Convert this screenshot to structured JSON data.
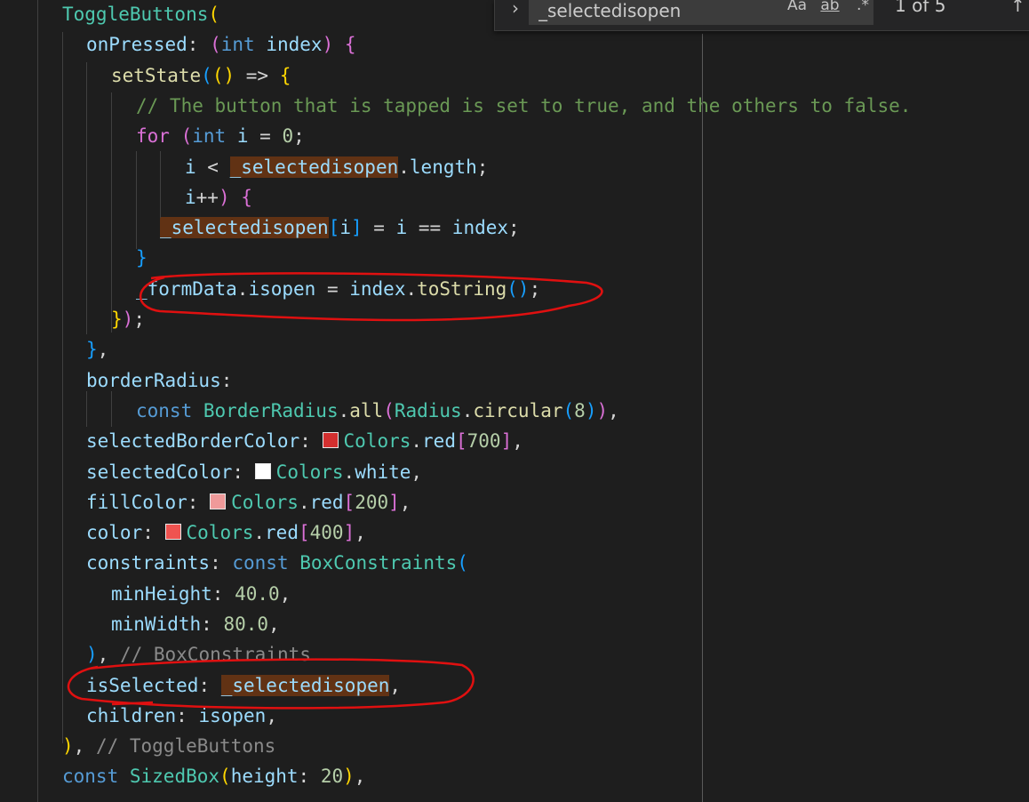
{
  "find_widget": {
    "toggle_icon": "chevron-right-icon",
    "query": "_selectedisopen",
    "match_case_label": "Aa",
    "whole_word_label": "ab",
    "regex_label": ".*",
    "match_count": "1 of 5",
    "prev_icon": "arrow-up-icon"
  },
  "colors": {
    "keyword": "#569cd6",
    "type": "#4ec9b0",
    "function": "#dcdcaa",
    "variable": "#9cdcfe",
    "number": "#b5cea8",
    "comment": "#6a9955",
    "text": "#d4d4d4",
    "bracket_gold": "#ffd700",
    "bracket_pink": "#da70d6",
    "bracket_blue": "#179fff",
    "find_highlight": "#613214",
    "annotation": "#e01010"
  },
  "code_lines": [
    {
      "tokens": [
        {
          "t": "ToggleButtons",
          "c": "type"
        },
        {
          "t": "(",
          "c": "bracket_gold"
        }
      ]
    },
    {
      "tokens": [
        {
          "t": "onPressed",
          "c": "variable"
        },
        {
          "t": ": ",
          "c": "text"
        },
        {
          "t": "(",
          "c": "bracket_pink"
        },
        {
          "t": "int",
          "c": "keyword"
        },
        {
          "t": " ",
          "c": "text"
        },
        {
          "t": "index",
          "c": "variable"
        },
        {
          "t": ") ",
          "c": "bracket_pink"
        },
        {
          "t": "{",
          "c": "bracket_pink"
        }
      ]
    },
    {
      "tokens": [
        {
          "t": "setState",
          "c": "function"
        },
        {
          "t": "(",
          "c": "bracket_blue"
        },
        {
          "t": "()",
          "c": "bracket_gold"
        },
        {
          "t": " => ",
          "c": "text"
        },
        {
          "t": "{",
          "c": "bracket_gold"
        }
      ]
    },
    {
      "tokens": [
        {
          "t": "// The button that is tapped is set to true, and the others to false.",
          "c": "comment"
        }
      ]
    },
    {
      "tokens": [
        {
          "t": "for",
          "c": "bracket_pink"
        },
        {
          "t": " ",
          "c": "text"
        },
        {
          "t": "(",
          "c": "bracket_pink"
        },
        {
          "t": "int",
          "c": "keyword"
        },
        {
          "t": " ",
          "c": "text"
        },
        {
          "t": "i",
          "c": "variable"
        },
        {
          "t": " = ",
          "c": "text"
        },
        {
          "t": "0",
          "c": "number"
        },
        {
          "t": ";",
          "c": "text"
        }
      ]
    },
    {
      "tokens": [
        {
          "t": "i",
          "c": "variable"
        },
        {
          "t": " < ",
          "c": "text"
        },
        {
          "t": "_selectedisopen",
          "c": "variable",
          "hl": true
        },
        {
          "t": ".",
          "c": "text"
        },
        {
          "t": "length",
          "c": "variable"
        },
        {
          "t": ";",
          "c": "text"
        }
      ]
    },
    {
      "tokens": [
        {
          "t": "i",
          "c": "variable"
        },
        {
          "t": "++",
          "c": "text"
        },
        {
          "t": ") ",
          "c": "bracket_pink"
        },
        {
          "t": "{",
          "c": "bracket_pink"
        }
      ]
    },
    {
      "tokens": [
        {
          "t": "_selectedisopen",
          "c": "variable",
          "hl": true
        },
        {
          "t": "[",
          "c": "bracket_blue"
        },
        {
          "t": "i",
          "c": "variable"
        },
        {
          "t": "]",
          "c": "bracket_blue"
        },
        {
          "t": " = ",
          "c": "text"
        },
        {
          "t": "i",
          "c": "variable"
        },
        {
          "t": " == ",
          "c": "text"
        },
        {
          "t": "index",
          "c": "variable"
        },
        {
          "t": ";",
          "c": "text"
        }
      ]
    },
    {
      "tokens": [
        {
          "t": "}",
          "c": "bracket_blue"
        }
      ]
    },
    {
      "tokens": [
        {
          "t": "_formData",
          "c": "variable"
        },
        {
          "t": ".",
          "c": "text"
        },
        {
          "t": "isopen",
          "c": "variable"
        },
        {
          "t": " = ",
          "c": "text"
        },
        {
          "t": "index",
          "c": "variable"
        },
        {
          "t": ".",
          "c": "text"
        },
        {
          "t": "toString",
          "c": "function"
        },
        {
          "t": "()",
          "c": "bracket_blue"
        },
        {
          "t": ";",
          "c": "text"
        }
      ]
    },
    {
      "tokens": [
        {
          "t": "}",
          "c": "bracket_gold"
        },
        {
          "t": ")",
          "c": "bracket_pink"
        },
        {
          "t": ";",
          "c": "text"
        }
      ]
    },
    {
      "tokens": [
        {
          "t": "}",
          "c": "bracket_blue"
        },
        {
          "t": ",",
          "c": "text"
        }
      ]
    },
    {
      "tokens": [
        {
          "t": "borderRadius",
          "c": "variable"
        },
        {
          "t": ":",
          "c": "text"
        }
      ]
    },
    {
      "tokens": [
        {
          "t": "const",
          "c": "keyword"
        },
        {
          "t": " ",
          "c": "text"
        },
        {
          "t": "BorderRadius",
          "c": "type"
        },
        {
          "t": ".",
          "c": "text"
        },
        {
          "t": "all",
          "c": "function"
        },
        {
          "t": "(",
          "c": "bracket_pink"
        },
        {
          "t": "Radius",
          "c": "type"
        },
        {
          "t": ".",
          "c": "text"
        },
        {
          "t": "circular",
          "c": "function"
        },
        {
          "t": "(",
          "c": "bracket_blue"
        },
        {
          "t": "8",
          "c": "number"
        },
        {
          "t": ")",
          "c": "bracket_blue"
        },
        {
          "t": ")",
          "c": "bracket_pink"
        },
        {
          "t": ",",
          "c": "text"
        }
      ]
    },
    {
      "tokens": [
        {
          "t": "selectedBorderColor",
          "c": "variable"
        },
        {
          "t": ": ",
          "c": "text"
        },
        {
          "swatch": "#d32f2f"
        },
        {
          "t": "Colors",
          "c": "type"
        },
        {
          "t": ".",
          "c": "text"
        },
        {
          "t": "red",
          "c": "variable"
        },
        {
          "t": "[",
          "c": "bracket_pink"
        },
        {
          "t": "700",
          "c": "number"
        },
        {
          "t": "]",
          "c": "bracket_pink"
        },
        {
          "t": ",",
          "c": "text"
        }
      ]
    },
    {
      "tokens": [
        {
          "t": "selectedColor",
          "c": "variable"
        },
        {
          "t": ": ",
          "c": "text"
        },
        {
          "swatch": "#ffffff"
        },
        {
          "t": "Colors",
          "c": "type"
        },
        {
          "t": ".",
          "c": "text"
        },
        {
          "t": "white",
          "c": "variable"
        },
        {
          "t": ",",
          "c": "text"
        }
      ]
    },
    {
      "tokens": [
        {
          "t": "fillColor",
          "c": "variable"
        },
        {
          "t": ": ",
          "c": "text"
        },
        {
          "swatch": "#ef9a9a"
        },
        {
          "t": "Colors",
          "c": "type"
        },
        {
          "t": ".",
          "c": "text"
        },
        {
          "t": "red",
          "c": "variable"
        },
        {
          "t": "[",
          "c": "bracket_pink"
        },
        {
          "t": "200",
          "c": "number"
        },
        {
          "t": "]",
          "c": "bracket_pink"
        },
        {
          "t": ",",
          "c": "text"
        }
      ]
    },
    {
      "tokens": [
        {
          "t": "color",
          "c": "variable"
        },
        {
          "t": ": ",
          "c": "text"
        },
        {
          "swatch": "#ef5350"
        },
        {
          "t": "Colors",
          "c": "type"
        },
        {
          "t": ".",
          "c": "text"
        },
        {
          "t": "red",
          "c": "variable"
        },
        {
          "t": "[",
          "c": "bracket_pink"
        },
        {
          "t": "400",
          "c": "number"
        },
        {
          "t": "]",
          "c": "bracket_pink"
        },
        {
          "t": ",",
          "c": "text"
        }
      ]
    },
    {
      "tokens": [
        {
          "t": "constraints",
          "c": "variable"
        },
        {
          "t": ": ",
          "c": "text"
        },
        {
          "t": "const",
          "c": "keyword"
        },
        {
          "t": " ",
          "c": "text"
        },
        {
          "t": "BoxConstraints",
          "c": "type"
        },
        {
          "t": "(",
          "c": "bracket_blue"
        }
      ]
    },
    {
      "tokens": [
        {
          "t": "minHeight",
          "c": "variable"
        },
        {
          "t": ": ",
          "c": "text"
        },
        {
          "t": "40.0",
          "c": "number"
        },
        {
          "t": ",",
          "c": "text"
        }
      ]
    },
    {
      "tokens": [
        {
          "t": "minWidth",
          "c": "variable"
        },
        {
          "t": ": ",
          "c": "text"
        },
        {
          "t": "80.0",
          "c": "number"
        },
        {
          "t": ",",
          "c": "text"
        }
      ]
    },
    {
      "tokens": [
        {
          "t": ")",
          "c": "bracket_blue"
        },
        {
          "t": ", ",
          "c": "text"
        },
        {
          "t": "// BoxConstraints",
          "c": "comment_dim"
        }
      ]
    },
    {
      "tokens": [
        {
          "t": "isSelected",
          "c": "variable"
        },
        {
          "t": ": ",
          "c": "text"
        },
        {
          "t": "_selectedisopen",
          "c": "variable",
          "hl": true
        },
        {
          "t": ",",
          "c": "text"
        }
      ]
    },
    {
      "tokens": [
        {
          "t": "children",
          "c": "variable"
        },
        {
          "t": ": ",
          "c": "text"
        },
        {
          "t": "isopen",
          "c": "variable"
        },
        {
          "t": ",",
          "c": "text"
        }
      ]
    },
    {
      "tokens": [
        {
          "t": ")",
          "c": "bracket_gold"
        },
        {
          "t": ", ",
          "c": "text"
        },
        {
          "t": "// ToggleButtons",
          "c": "comment_dim"
        }
      ]
    },
    {
      "tokens": [
        {
          "t": "const",
          "c": "keyword"
        },
        {
          "t": " ",
          "c": "text"
        },
        {
          "t": "SizedBox",
          "c": "type"
        },
        {
          "t": "(",
          "c": "bracket_gold"
        },
        {
          "t": "height",
          "c": "variable"
        },
        {
          "t": ": ",
          "c": "text"
        },
        {
          "t": "20",
          "c": "number"
        },
        {
          "t": ")",
          "c": "bracket_gold"
        },
        {
          "t": ",",
          "c": "text"
        }
      ]
    }
  ]
}
